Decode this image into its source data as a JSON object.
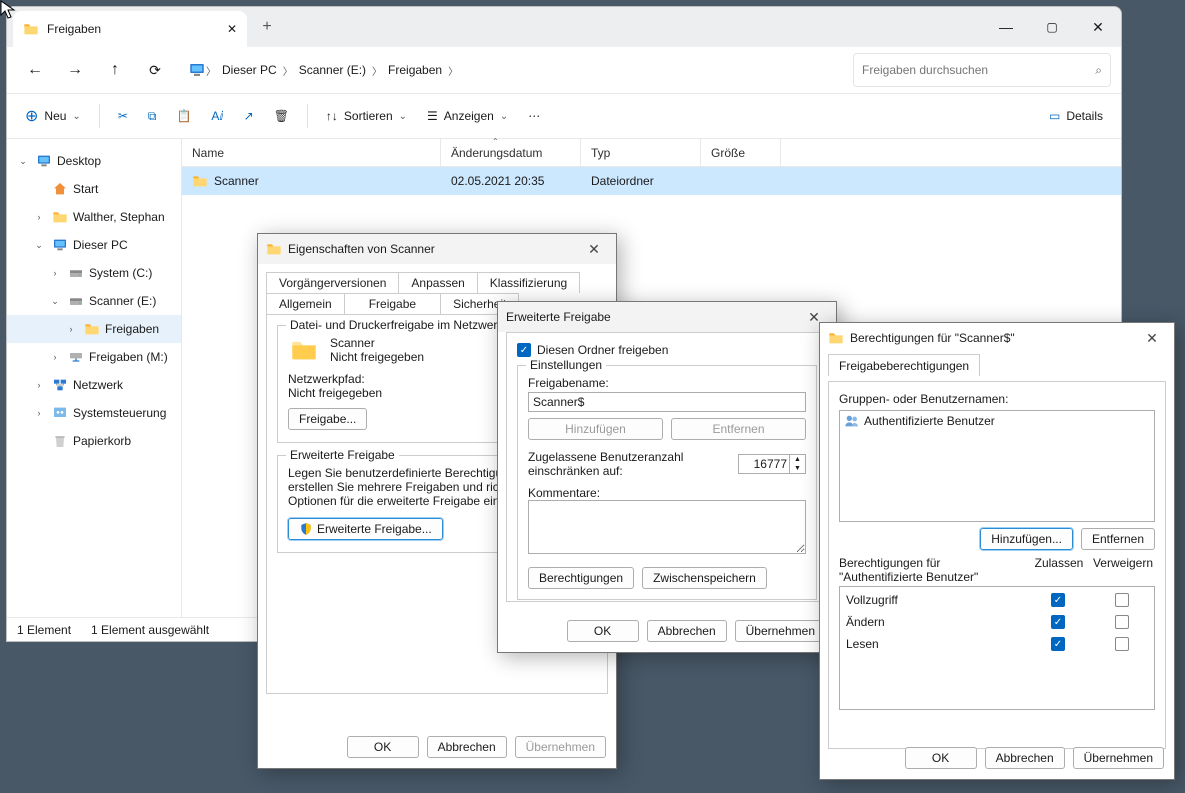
{
  "tab_title": "Freigaben",
  "breadcrumb": [
    "Dieser PC",
    "Scanner (E:)",
    "Freigaben"
  ],
  "search_placeholder": "Freigaben durchsuchen",
  "toolbar": {
    "new": "Neu",
    "sort": "Sortieren",
    "view": "Anzeigen",
    "details": "Details"
  },
  "columns": {
    "name": "Name",
    "date": "Änderungsdatum",
    "type": "Typ",
    "size": "Größe"
  },
  "row": {
    "name": "Scanner",
    "date": "02.05.2021 20:35",
    "type": "Dateiordner"
  },
  "tree": {
    "desktop": "Desktop",
    "start": "Start",
    "user": "Walther, Stephan",
    "thispc": "Dieser PC",
    "sysc": "System (C:)",
    "scannere": "Scanner (E:)",
    "freigaben": "Freigaben",
    "freigabenm": "Freigaben (M:)",
    "network": "Netzwerk",
    "control": "Systemsteuerung",
    "recycle": "Papierkorb"
  },
  "status": {
    "count": "1 Element",
    "sel": "1 Element ausgewählt"
  },
  "d1": {
    "title": "Eigenschaften von Scanner",
    "tabs": {
      "prev": "Vorgängerversionen",
      "custom": "Anpassen",
      "class": "Klassifizierung",
      "general": "Allgemein",
      "share": "Freigabe",
      "security": "Sicherheit"
    },
    "g1": "Datei- und Druckerfreigabe im Netzwerk",
    "name": "Scanner",
    "state": "Nicht freigegeben",
    "pathlabel": "Netzwerkpfad:",
    "path": "Nicht freigegeben",
    "sharebtn": "Freigabe...",
    "g2": "Erweiterte Freigabe",
    "desc": "Legen Sie benutzerdefinierte Berechtigungen fest, erstellen Sie mehrere Freigaben und richten Sie Optionen für die erweiterte Freigabe ein.",
    "advbtn": "Erweiterte Freigabe...",
    "ok": "OK",
    "cancel": "Abbrechen",
    "apply": "Übernehmen"
  },
  "d2": {
    "title": "Erweiterte Freigabe",
    "chk": "Diesen Ordner freigeben",
    "settings": "Einstellungen",
    "namelabel": "Freigabename:",
    "name": "Scanner$",
    "add": "Hinzufügen",
    "remove": "Entfernen",
    "limit": "Zugelassene Benutzeranzahl einschränken auf:",
    "limitval": "16777",
    "comments": "Kommentare:",
    "perm": "Berechtigungen",
    "cache": "Zwischenspeichern",
    "ok": "OK",
    "cancel": "Abbrechen",
    "apply": "Übernehmen"
  },
  "d3": {
    "title": "Berechtigungen für \"Scanner$\"",
    "tab": "Freigabeberechtigungen",
    "userslabel": "Gruppen- oder Benutzernamen:",
    "user": "Authentifizierte Benutzer",
    "add": "Hinzufügen...",
    "remove": "Entfernen",
    "permfor": "Berechtigungen für \"Authentifizierte Benutzer\"",
    "allow": "Zulassen",
    "deny": "Verweigern",
    "rows": [
      {
        "label": "Vollzugriff",
        "allow": true,
        "deny": false
      },
      {
        "label": "Ändern",
        "allow": true,
        "deny": false
      },
      {
        "label": "Lesen",
        "allow": true,
        "deny": false
      }
    ],
    "ok": "OK",
    "cancel": "Abbrechen",
    "apply": "Übernehmen"
  }
}
